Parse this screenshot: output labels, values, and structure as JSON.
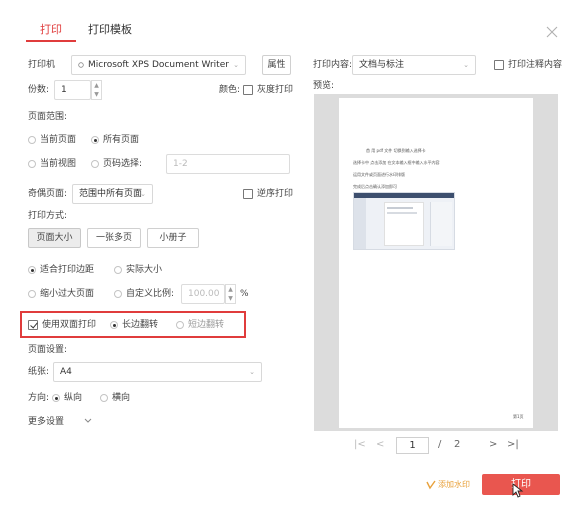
{
  "tabs": [
    {
      "label": "打印"
    },
    {
      "label": "打印模板"
    }
  ],
  "printer": {
    "label": "打印机",
    "selected": "Microsoft XPS Document Writer",
    "properties_button": "属性"
  },
  "copies": {
    "label": "份数:",
    "value": "1"
  },
  "color": {
    "label": "颜色:",
    "grayscale_label": "灰度打印",
    "grayscale_checked": false
  },
  "print_content": {
    "label": "打印内容:",
    "selected": "文档与标注",
    "annotations_label": "打印注释内容",
    "annotations_checked": false
  },
  "preview_label": "预览:",
  "page_range": {
    "label": "页面范围:",
    "current_page": "当前页面",
    "all_pages": "所有页面",
    "current_view": "当前视图",
    "page_select": "页码选择:",
    "page_select_placeholder": "1-2",
    "selected": "all_pages"
  },
  "odd_even": {
    "label": "奇偶页面:",
    "selected": "范围中所有页面",
    "reverse_label": "逆序打印",
    "reverse_checked": false
  },
  "print_mode": {
    "label": "打印方式:",
    "buttons": [
      {
        "label": "页面大小"
      },
      {
        "label": "一张多页"
      },
      {
        "label": "小册子"
      }
    ],
    "selected": "页面大小"
  },
  "scaling": {
    "fit_margins": "适合打印边距",
    "actual_size": "实际大小",
    "shrink_large": "缩小过大页面",
    "custom_scale": "自定义比例:",
    "custom_value": "100.00",
    "percent": "%",
    "selected": "fit_margins"
  },
  "duplex": {
    "label": "使用双面打印",
    "checked": true,
    "long_edge": "长边翻转",
    "short_edge": "短边翻转",
    "selected": "long_edge"
  },
  "page_setup": {
    "label": "页面设置:",
    "paper_label": "纸张:",
    "paper_value": "A4",
    "orientation_label": "方向:",
    "portrait": "纵向",
    "landscape": "横向",
    "orientation_selected": "portrait",
    "more_settings": "更多设置"
  },
  "preview": {
    "lines": [
      "首 用 pdf 文件    切换到输入选择卡",
      "选择卡中   点击添加   在文本输入框中输入水平内容",
      "运用文件或页面进行水印排版",
      "完成后点击确认添加即可"
    ],
    "page_number": "第1页"
  },
  "pagination": {
    "first": "|<",
    "prev": "<",
    "current": "1",
    "separator": "/",
    "total": "2",
    "next": ">",
    "last": ">|"
  },
  "actions": {
    "add_watermark": "添加水印",
    "print": "打印"
  },
  "colors": {
    "accent": "#e03c3c",
    "print_button": "#e9564f",
    "watermark_link": "#e8a13b"
  }
}
